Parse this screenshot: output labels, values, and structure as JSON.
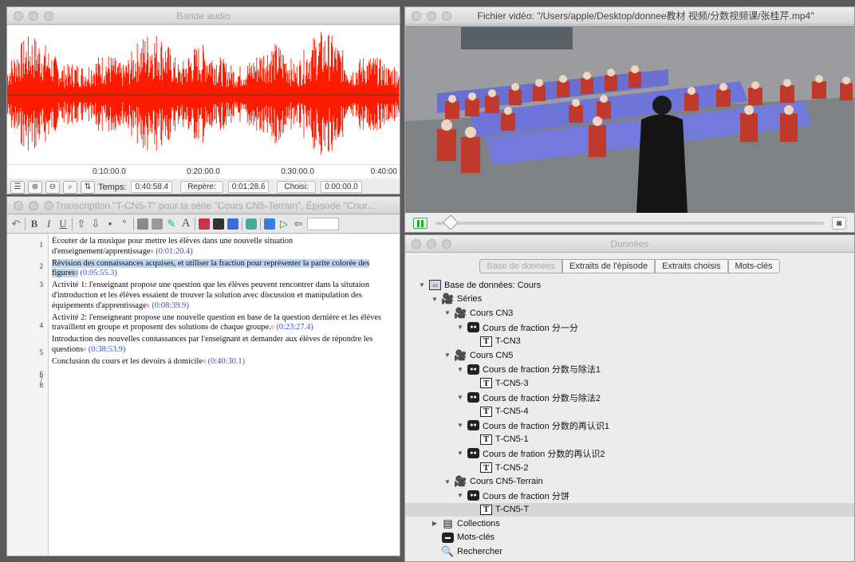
{
  "audio_window": {
    "title": "Bande audio",
    "ruler": [
      "0:10:00.0",
      "0:20:00.0",
      "0:30:00.0",
      "0:40:00"
    ],
    "temps_label": "Temps:",
    "temps_value": "0:40:58.4",
    "repere_label": "Repère:",
    "repere_value": "0:01:28.6",
    "choisi_label": "Choisi:",
    "choisi_value": "0:00:00.0",
    "wave_color": "#ff1a00"
  },
  "transcript_window": {
    "title": "Transcription \"T-CN5-T\" pour la série \"Cours CN5-Terrain\", Épisode \"Cour...",
    "line_numbers": [
      "1",
      "2",
      "3",
      "4",
      "5",
      "6",
      "7",
      "8"
    ],
    "paragraphs": [
      {
        "text": "Écouter de la musique pour mettre les élèves dans une nouvelle situation d'enseignement/apprentissage",
        "time": "(0:01:20.4)"
      },
      {
        "text": "Révision des connaissances acquises, et utiliser la fraction pour représenter la parite colorée des figures",
        "time": "(0:05:55.3)"
      },
      {
        "text": "Activité 1: l'enseignant propose une question que les élèves peuvent rencontrer dans la situtaion d'introduction et les élèves essaient de trouver la solution avec discussion et manipulation des équipements d'apprentissage",
        "time": "(0:08:39.9)"
      },
      {
        "text": "Activité 2: l'enseigneant propose une nouvelle question en base de la question dernière et les élèves travaillent en groupe et proposent des solutions de chaque groupe.",
        "time": "(0:23:27.4)"
      },
      {
        "text": "Introduction des nouvelles connassances par l'enseignant et demander aux élèves de répondre les questions",
        "time": "(0:38:53.9)"
      },
      {
        "text": "Conclusion du cours et les devoirs à domicile",
        "time": "(0:40:30.1)"
      }
    ]
  },
  "video_window": {
    "title": "Fichier vidéo: \"/Users/apple/Desktop/donnee教材 视频/分数视频课/张桂芹.mp4\""
  },
  "data_window": {
    "title": "Données",
    "tabs": [
      "Base de données",
      "Extraits de l'épisode",
      "Extraits choisis",
      "Mots-clés"
    ],
    "tree": [
      {
        "label": "Base de données: Cours",
        "icon": "database-icon",
        "level": 0,
        "expanded": true
      },
      {
        "label": "Séries",
        "icon": "film-camera-icon",
        "level": 1,
        "expanded": true
      },
      {
        "label": "Cours CN3",
        "icon": "film-camera-icon",
        "level": 2,
        "expanded": true
      },
      {
        "label": "Cours de fraction 分一分",
        "icon": "video-camera-icon",
        "level": 3,
        "expanded": true
      },
      {
        "label": "T-CN3",
        "icon": "transcript-icon",
        "level": 4
      },
      {
        "label": "Cours CN5",
        "icon": "film-camera-icon",
        "level": 2,
        "expanded": true
      },
      {
        "label": "Cours de fraction 分数与除法1",
        "icon": "video-camera-icon",
        "level": 3,
        "expanded": true
      },
      {
        "label": "T-CN5-3",
        "icon": "transcript-icon",
        "level": 4
      },
      {
        "label": "Cours de fraction 分数与除法2",
        "icon": "video-camera-icon",
        "level": 3,
        "expanded": true
      },
      {
        "label": "T-CN5-4",
        "icon": "transcript-icon",
        "level": 4
      },
      {
        "label": "Cours de fraction 分数的再认识1",
        "icon": "video-camera-icon",
        "level": 3,
        "expanded": true
      },
      {
        "label": "T-CN5-1",
        "icon": "transcript-icon",
        "level": 4
      },
      {
        "label": "Cours de fration 分数的再认识2",
        "icon": "video-camera-icon",
        "level": 3,
        "expanded": true
      },
      {
        "label": "T-CN5-2",
        "icon": "transcript-icon",
        "level": 4
      },
      {
        "label": "Cours CN5-Terrain",
        "icon": "film-camera-icon",
        "level": 2,
        "expanded": true
      },
      {
        "label": "Cours de fraction 分饼",
        "icon": "video-camera-icon",
        "level": 3,
        "expanded": true
      },
      {
        "label": "T-CN5-T",
        "icon": "transcript-icon",
        "level": 4,
        "selected": true
      },
      {
        "label": "Collections",
        "icon": "collections-icon",
        "level": 1,
        "expanded": false
      },
      {
        "label": "Mots-clés",
        "icon": "keywords-icon",
        "level": 1
      },
      {
        "label": "Rechercher",
        "icon": "search-icon",
        "level": 1
      }
    ]
  }
}
